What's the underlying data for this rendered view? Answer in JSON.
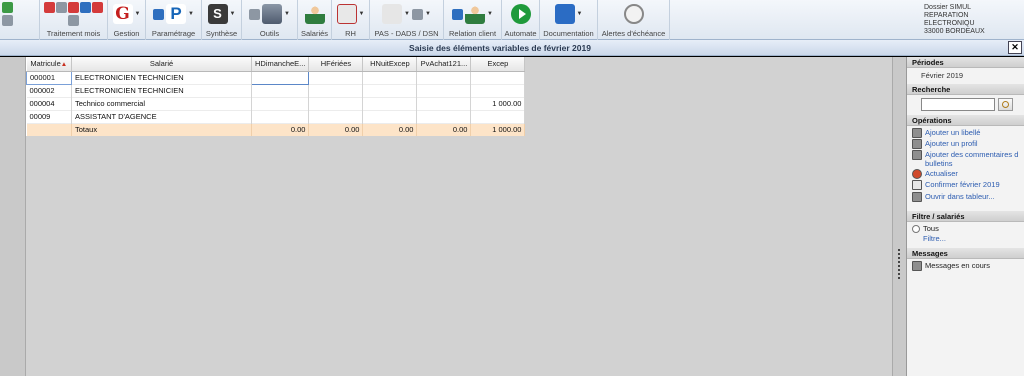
{
  "ribbon": {
    "groups": [
      {
        "key": "traitement",
        "label": "Traitement mois"
      },
      {
        "key": "gestion",
        "label": "Gestion"
      },
      {
        "key": "parametrage",
        "label": "Paramétrage"
      },
      {
        "key": "synthese",
        "label": "Synthèse"
      },
      {
        "key": "outils",
        "label": "Outils"
      },
      {
        "key": "salaries",
        "label": "Salariés"
      },
      {
        "key": "rh",
        "label": "RH"
      },
      {
        "key": "pas",
        "label": "PAS - DADS / DSN"
      },
      {
        "key": "relation",
        "label": "Relation client"
      },
      {
        "key": "automate",
        "label": "Automate"
      },
      {
        "key": "documentation",
        "label": "Documentation"
      },
      {
        "key": "alertes",
        "label": "Alertes d'échéance"
      }
    ],
    "icon_glyphs": {
      "gestion": "G",
      "parametrage": "P",
      "synthese": "S"
    },
    "icon_names": [
      "calendar-icon",
      "g-logo-icon",
      "p-logo-icon",
      "synthese-icon",
      "tools-icon",
      "employee-icon",
      "rh-icon",
      "bank-icon",
      "client-icon",
      "play-icon",
      "documentation-icon",
      "alarm-clock-icon"
    ]
  },
  "company": {
    "line1": "Dossier SIMUL",
    "line2": "REPARATION ELECTRONIQU",
    "line3": "33000 BORDEAUX"
  },
  "window": {
    "title": "Saisie des éléments variables de février 2019",
    "close": "✕"
  },
  "grid": {
    "columns": {
      "matricule": "Matricule",
      "sort_arrow": "▲",
      "salarie": "Salarié",
      "hdim": "HDimancheE...",
      "hferiees": "HFériées",
      "hnuit": "HNuitExcep",
      "pvachat": "PvAchat121...",
      "excep": "Excep"
    },
    "rows": [
      {
        "matricule": "000001",
        "salarie": "ELECTRONICIEN TECHNICIEN",
        "hdim": "",
        "hferiees": "",
        "hnuit": "",
        "pvachat": "",
        "excep": ""
      },
      {
        "matricule": "000002",
        "salarie": "ELECTRONICIEN TECHNICIEN",
        "hdim": "",
        "hferiees": "",
        "hnuit": "",
        "pvachat": "",
        "excep": ""
      },
      {
        "matricule": "000004",
        "salarie": "Technico commercial",
        "hdim": "",
        "hferiees": "",
        "hnuit": "",
        "pvachat": "",
        "excep": "1 000.00"
      },
      {
        "matricule": "00009",
        "salarie": "ASSISTANT D'AGENCE",
        "hdim": "",
        "hferiees": "",
        "hnuit": "",
        "pvachat": "",
        "excep": ""
      }
    ],
    "totals": {
      "label": "Totaux",
      "hdim": "0.00",
      "hferiees": "0.00",
      "hnuit": "0.00",
      "pvachat": "0.00",
      "excep": "1 000.00"
    }
  },
  "side": {
    "periodes": {
      "title": "Périodes",
      "value": "Février 2019"
    },
    "recherche": {
      "title": "Recherche",
      "placeholder": ""
    },
    "operations": {
      "title": "Opérations",
      "items": [
        "Ajouter un libellé",
        "Ajouter un profil",
        "Ajouter des commentaires d",
        "bulletins",
        "Actualiser",
        "Confirmer février 2019",
        "Ouvrir dans tableur..."
      ]
    },
    "filtre": {
      "title": "Filtre / salariés",
      "tous": "Tous",
      "filtre": "Filtre..."
    },
    "messages": {
      "title": "Messages",
      "item": "Messages en cours"
    }
  },
  "colors": {
    "accent": "#2c5cb0",
    "totals_bg": "#fde4c8",
    "title_bg": "#cbd8ea"
  }
}
